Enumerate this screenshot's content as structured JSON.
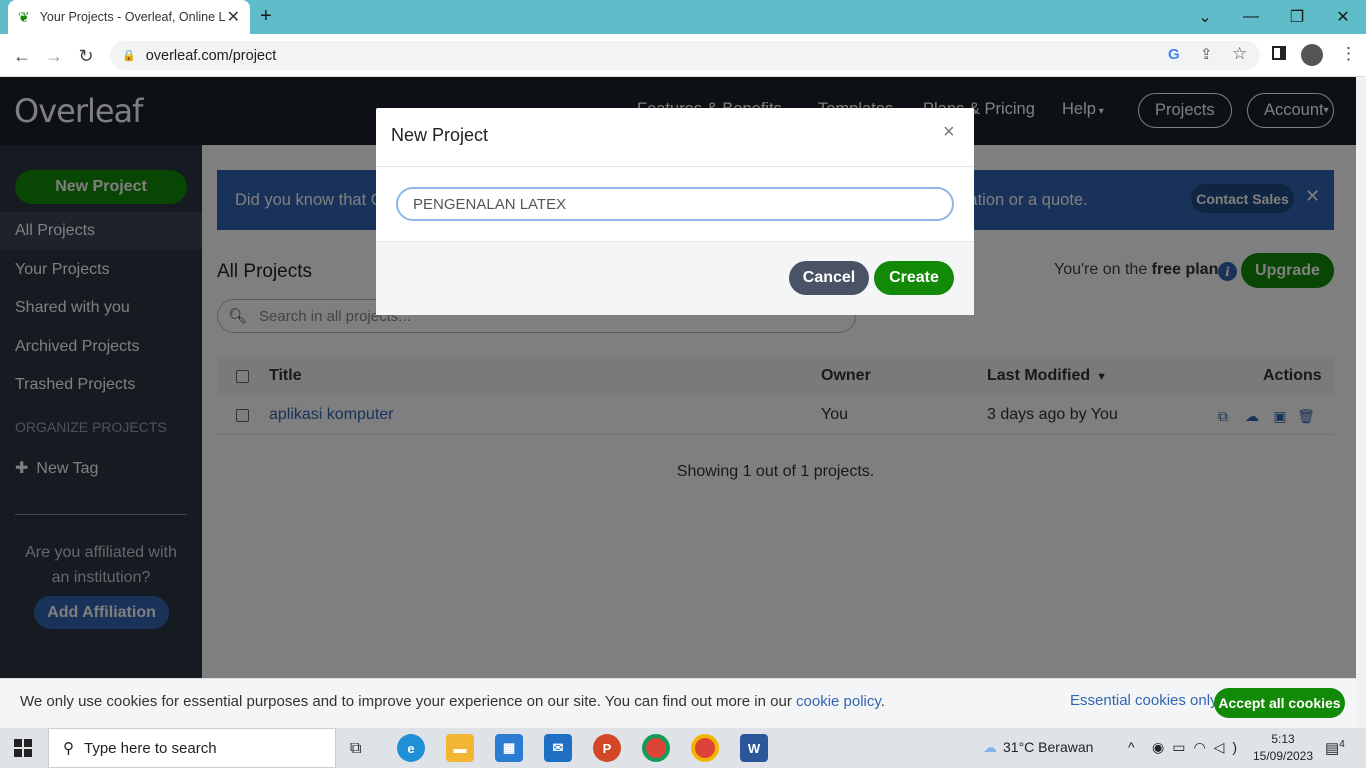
{
  "browser": {
    "tab_title": "Your Projects - Overleaf, Online L",
    "url": "overleaf.com/project"
  },
  "header": {
    "logo": "Overleaf",
    "nav": [
      "Features & Benefits",
      "Templates",
      "Plans & Pricing",
      "Help"
    ],
    "projects_btn": "Projects",
    "account_btn": "Account"
  },
  "sidebar": {
    "new_project": "New Project",
    "items": [
      "All Projects",
      "Your Projects",
      "Shared with you",
      "Archived Projects",
      "Trashed Projects"
    ],
    "organize_heading": "ORGANIZE PROJECTS",
    "new_tag": "New Tag",
    "affiliation_question": "Are you affiliated with an institution?",
    "add_affiliation": "Add Affiliation"
  },
  "banner": {
    "text": "Did you know that Overleaf offers group and organization-wide plans? Contact Sales for more information or a quote.",
    "contact_btn": "Contact Sales"
  },
  "main": {
    "title": "All Projects",
    "plan_prefix": "You're on the ",
    "plan_name": "free plan",
    "upgrade_btn": "Upgrade",
    "search_placeholder": "Search in all projects...",
    "columns": {
      "title": "Title",
      "owner": "Owner",
      "last_modified": "Last Modified",
      "actions": "Actions"
    },
    "rows": [
      {
        "title": "aplikasi komputer",
        "owner": "You",
        "modified": "3 days ago by You"
      }
    ],
    "showing": "Showing 1 out of 1 projects."
  },
  "modal": {
    "title": "New Project",
    "input_value": "PENGENALAN LATEX",
    "cancel": "Cancel",
    "create": "Create"
  },
  "cookie": {
    "text": "We only use cookies for essential purposes and to improve your experience on our site. You can find out more in our ",
    "link": "cookie policy",
    "essential": "Essential cookies only",
    "accept_all": "Accept all cookies"
  },
  "taskbar": {
    "search": "Type here to search",
    "weather": "31°C  Berawan",
    "time": "5:13",
    "date": "15/09/2023",
    "notifications": "4"
  },
  "colors": {
    "green": "#138a07",
    "blue": "#3265b2",
    "dark": "#1b222c"
  }
}
